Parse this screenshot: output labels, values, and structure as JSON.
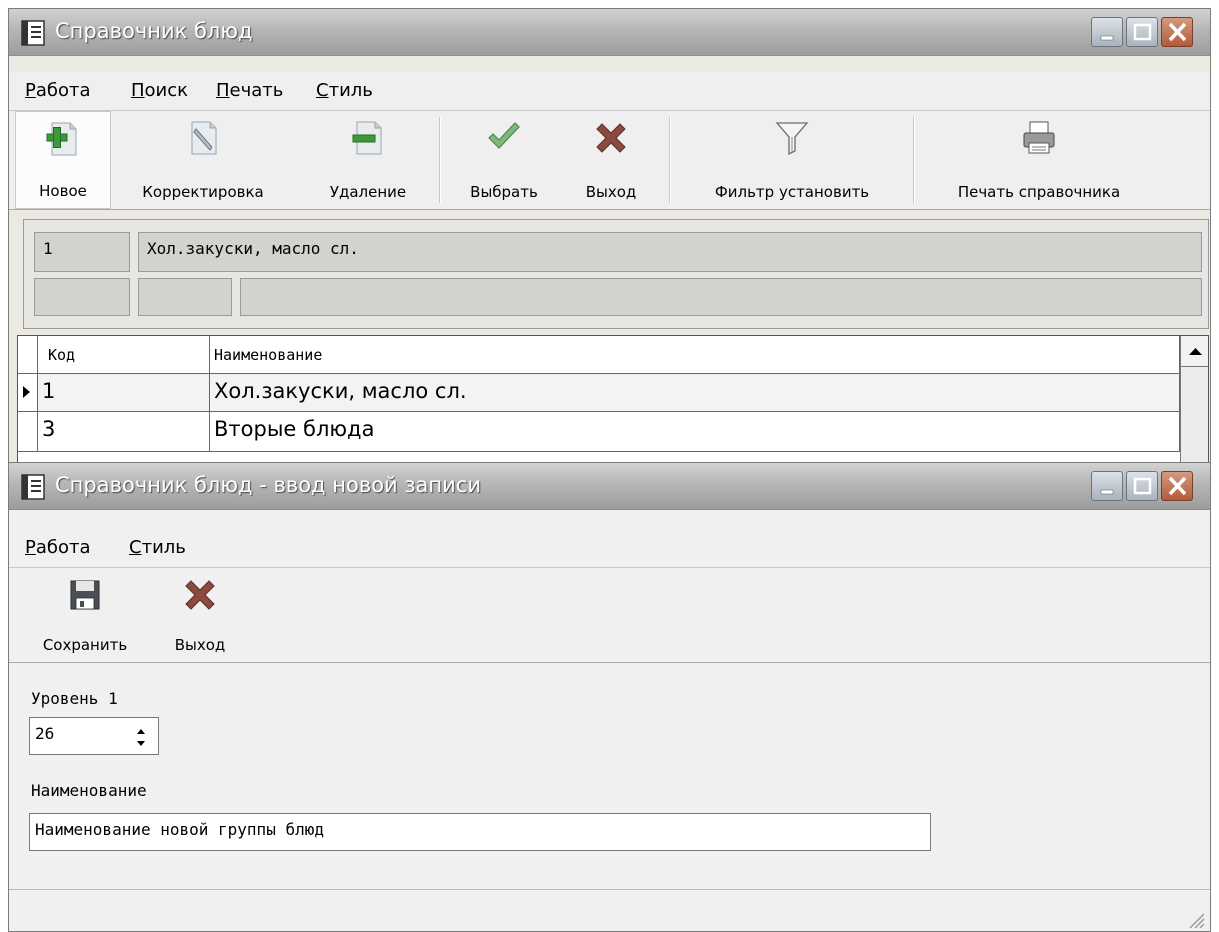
{
  "main_window": {
    "title": "Справочник блюд",
    "menu": [
      {
        "accel": "Р",
        "rest": "абота"
      },
      {
        "accel": "П",
        "rest": "оиск"
      },
      {
        "accel": "П",
        "rest": "ечать"
      },
      {
        "accel": "С",
        "rest": "тиль"
      }
    ],
    "toolbar": {
      "new_label": "Новое",
      "edit_label": "Корректировка",
      "delete_label": "Удаление",
      "select_label": "Выбрать",
      "exit_label": "Выход",
      "filter_label": "Фильтр установить",
      "print_label": "Печать справочника"
    },
    "detail": {
      "code": "1",
      "name": "Хол.закуски, масло сл.",
      "extra1": "",
      "extra2": "",
      "extra3": ""
    },
    "grid": {
      "columns": [
        "Код",
        "Наименование"
      ],
      "rows": [
        {
          "code": "1",
          "name": "Хол.закуски, масло сл."
        },
        {
          "code": "3",
          "name": "Вторые блюда"
        }
      ]
    }
  },
  "entry_window": {
    "title": "Справочник блюд - ввод новой записи",
    "menu": [
      {
        "accel": "Р",
        "rest": "абота"
      },
      {
        "accel": "С",
        "rest": "тиль"
      }
    ],
    "toolbar": {
      "save_label": "Сохранить",
      "exit_label": "Выход"
    },
    "level_label": "Уровень 1",
    "level_value": "26",
    "name_label": "Наименование",
    "name_value": "Наименование новой группы блюд"
  },
  "icons": {
    "app": "document-icon",
    "new": "add-record-icon",
    "edit": "edit-pencil-icon",
    "delete": "remove-record-icon",
    "select": "checkmark-icon",
    "exit": "red-x-icon",
    "filter": "funnel-icon",
    "print": "printer-icon",
    "save": "floppy-disk-icon"
  },
  "colors": {
    "title_gradient_top": "#d2d2d2",
    "title_gradient_bottom": "#9d9d9d",
    "window_bg": "#ece9e2",
    "detail_field_bg": "#d1d3ce",
    "close_button": "#b35a3a"
  }
}
